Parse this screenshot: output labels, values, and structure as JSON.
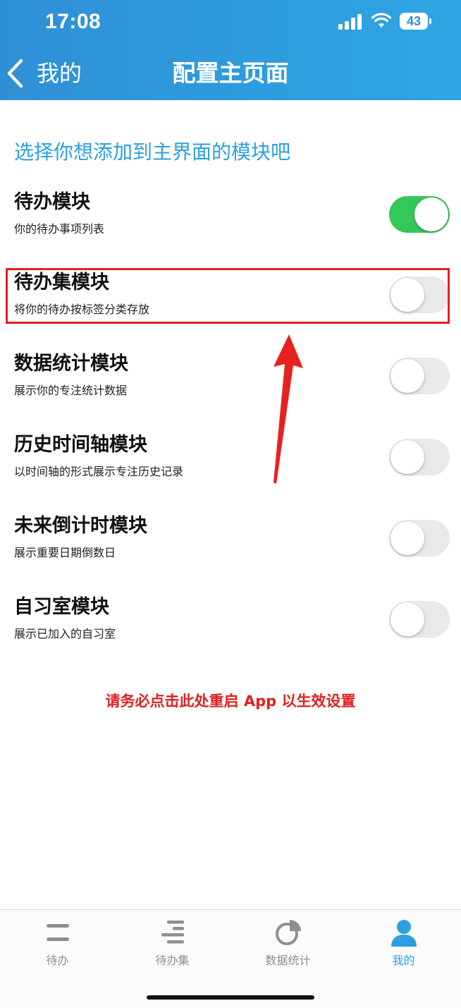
{
  "status_bar": {
    "time": "17:08",
    "battery": "43"
  },
  "nav": {
    "back_label": "我的",
    "title": "配置主页面"
  },
  "section_heading": "选择你想添加到主界面的模块吧",
  "modules": [
    {
      "title": "待办模块",
      "description": "你的待办事项列表",
      "enabled": true
    },
    {
      "title": "待办集模块",
      "description": "将你的待办按标签分类存放",
      "enabled": false
    },
    {
      "title": "数据统计模块",
      "description": "展示你的专注统计数据",
      "enabled": false
    },
    {
      "title": "历史时间轴模块",
      "description": "以时间轴的形式展示专注历史记录",
      "enabled": false
    },
    {
      "title": "未来倒计时模块",
      "description": "展示重要日期倒数日",
      "enabled": false
    },
    {
      "title": "自习室模块",
      "description": "展示已加入的自习室",
      "enabled": false
    }
  ],
  "restart_link": "请务必点击此处重启 App 以生效设置",
  "tabs": [
    {
      "label": "待办",
      "icon": "todo-lines-icon",
      "active": false
    },
    {
      "label": "待办集",
      "icon": "todo-collection-icon",
      "active": false
    },
    {
      "label": "数据统计",
      "icon": "pie-chart-icon",
      "active": false
    },
    {
      "label": "我的",
      "icon": "person-icon",
      "active": true
    }
  ],
  "colors": {
    "header": "#2f9ae0",
    "accent": "#2d9fe0",
    "toggle_on": "#34c759",
    "annotation_red": "#e02020"
  }
}
